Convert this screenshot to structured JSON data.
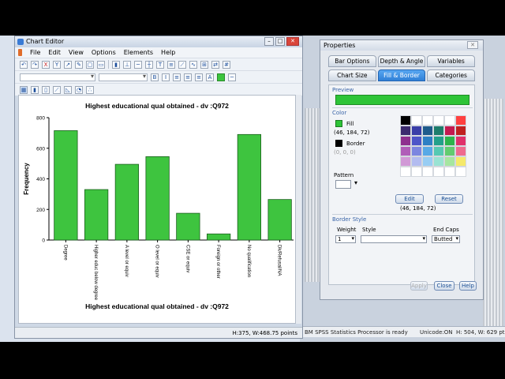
{
  "editor": {
    "title": "Chart Editor",
    "menu": [
      "File",
      "Edit",
      "View",
      "Options",
      "Elements",
      "Help"
    ],
    "status": "H:375, W:468.75 points"
  },
  "background": {
    "status_text": "BM SPSS Statistics Processor is ready",
    "unicode": "Unicode:ON",
    "size": "H: 504, W: 629 pt"
  },
  "properties": {
    "title": "Properties",
    "tabs_row1": [
      "Bar Options",
      "Depth & Angle",
      "Variables"
    ],
    "tabs_row2": [
      "Chart Size",
      "Fill & Border",
      "Categories"
    ],
    "active_tab": "Fill & Border",
    "preview_label": "Preview",
    "color_label": "Color",
    "fill_label": "Fill",
    "fill_rgb": "(46, 184, 72)",
    "border_label": "Border",
    "border_rgb": "(0, 0, 0)",
    "pattern_label": "Pattern",
    "edit_button": "Edit",
    "reset_button": "Reset",
    "selected_rgb": "(46, 184, 72)",
    "border_style_label": "Border Style",
    "weight_label": "Weight",
    "style_label": "Style",
    "endcaps_label": "End Caps",
    "weight_value": "1",
    "endcaps_value": "Butted",
    "apply_button": "Apply",
    "close_button": "Close",
    "help_button": "Help",
    "fill_color": "#2ec437"
  },
  "chart_data": {
    "type": "bar",
    "title": "Highest educational qual obtained - dv :Q972",
    "xlabel": "Highest educational qual obtained - dv :Q972",
    "ylabel": "Frequency",
    "categories": [
      "Degree",
      "Higher educ below degree",
      "A level or equiv",
      "O level or equiv",
      "CSE or equiv",
      "Foreign or other",
      "No qualification",
      "Dk/Refusal/NA"
    ],
    "values": [
      715,
      330,
      495,
      545,
      175,
      40,
      690,
      265
    ],
    "yticks": [
      "0",
      "200",
      "400",
      "600",
      "800"
    ],
    "ylim": [
      0,
      800
    ],
    "grid": false,
    "bar_color": "#3ec43f"
  }
}
